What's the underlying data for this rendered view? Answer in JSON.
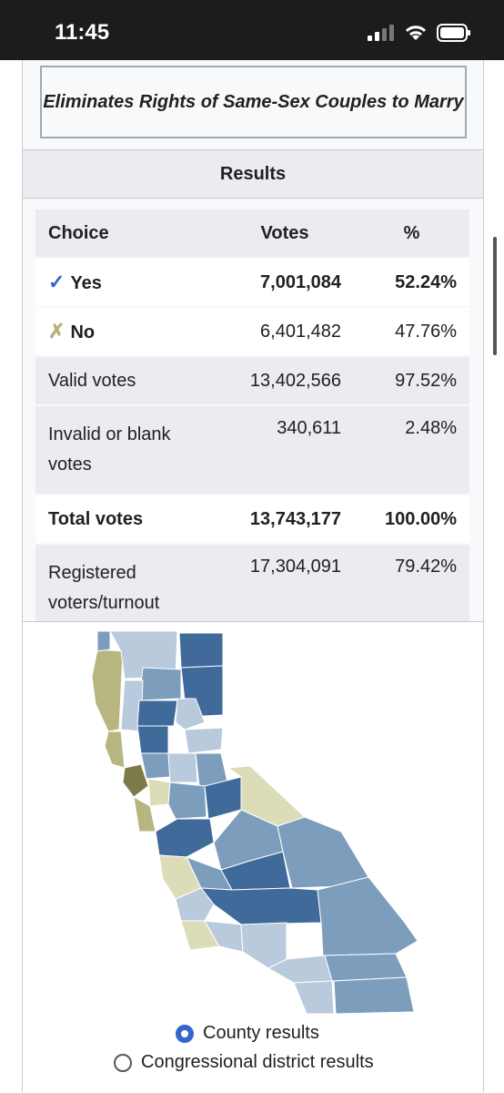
{
  "status": {
    "time": "11:45"
  },
  "title": "Eliminates Rights of Same-Sex Couples to Marry",
  "results_header": "Results",
  "table": {
    "headers": [
      "Choice",
      "Votes",
      "%"
    ],
    "yes": {
      "label": "Yes",
      "votes": "7,001,084",
      "pct": "52.24%"
    },
    "no": {
      "label": "No",
      "votes": "6,401,482",
      "pct": "47.76%"
    },
    "valid": {
      "label": "Valid votes",
      "votes": "13,402,566",
      "pct": "97.52%"
    },
    "invalid": {
      "label": "Invalid or blank votes",
      "votes": "340,611",
      "pct": "2.48%"
    },
    "total": {
      "label": "Total votes",
      "votes": "13,743,177",
      "pct": "100.00%"
    },
    "registered": {
      "label": "Registered voters/turnout",
      "votes": "17,304,091",
      "pct": "79.42%"
    }
  },
  "map": {
    "colors": {
      "yes_strong": "#3f6a9a",
      "yes_mid": "#7d9dbd",
      "yes_light": "#b8cadb",
      "no_light": "#dcdcb8",
      "no_mid": "#b8b680",
      "no_strong": "#7b7b4a"
    }
  },
  "options": {
    "county": "County results",
    "congressional": "Congressional district results"
  }
}
